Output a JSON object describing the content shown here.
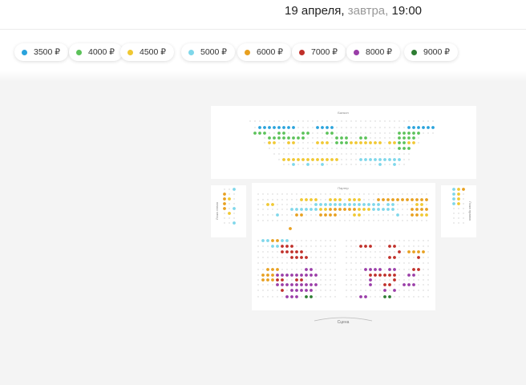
{
  "header": {
    "date": "19 апреля,",
    "relative_day": "завтра,",
    "time": "19:00"
  },
  "price_filters": [
    {
      "label": "3500 ₽",
      "color": "#2aa3dc"
    },
    {
      "label": "4000 ₽",
      "color": "#5cc25a"
    },
    {
      "label": "4500 ₽",
      "color": "#f0c832"
    },
    {
      "label": "5000 ₽",
      "color": "#7fd7ea"
    },
    {
      "label": "6000 ₽",
      "color": "#e8a020"
    },
    {
      "label": "7000 ₽",
      "color": "#c0302a"
    },
    {
      "label": "8000 ₽",
      "color": "#9a3ea8"
    },
    {
      "label": "9000 ₽",
      "color": "#2e7d32"
    }
  ],
  "hall": {
    "balcony_label": "Балкон",
    "parterre_label": "Партер",
    "box_left_label": "Ложа левая",
    "box_right_label": "Ложа правая",
    "stage_label": "Сцена"
  }
}
